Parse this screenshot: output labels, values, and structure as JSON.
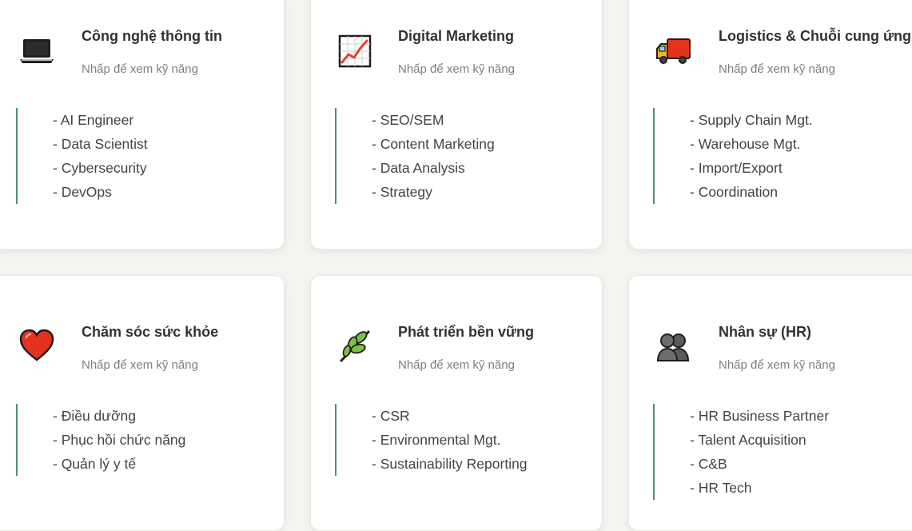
{
  "cards": [
    {
      "title": "Công nghệ thông tin",
      "subtitle": "Nhấp để xem kỹ năng",
      "icon": "laptop-icon",
      "skills": [
        "- AI Engineer",
        "- Data Scientist",
        "- Cybersecurity",
        "- DevOps"
      ]
    },
    {
      "title": "Digital Marketing",
      "subtitle": "Nhấp để xem kỹ năng",
      "icon": "chart-increasing-icon",
      "skills": [
        "- SEO/SEM",
        "- Content Marketing",
        "- Data Analysis",
        "- Strategy"
      ]
    },
    {
      "title": "Logistics & Chuỗi cung ứng",
      "subtitle": "Nhấp để xem kỹ năng",
      "icon": "delivery-truck-icon",
      "skills": [
        "- Supply Chain Mgt.",
        "- Warehouse Mgt.",
        "- Import/Export",
        "- Coordination"
      ]
    },
    {
      "title": "Chăm sóc sức khỏe",
      "subtitle": "Nhấp để xem kỹ năng",
      "icon": "heart-icon",
      "skills": [
        "- Điều dưỡng",
        "- Phục hồi chức năng",
        "- Quản lý y tế"
      ]
    },
    {
      "title": "Phát triển bền vững",
      "subtitle": "Nhấp để xem kỹ năng",
      "icon": "herb-icon",
      "skills": [
        "- CSR",
        "- Environmental Mgt.",
        "- Sustainability Reporting"
      ]
    },
    {
      "title": "Nhân sự (HR)",
      "subtitle": "Nhấp để xem kỹ năng",
      "icon": "busts-icon",
      "skills": [
        "- HR Business Partner",
        "- Talent Acquisition",
        "- C&B",
        "- HR Tech"
      ]
    }
  ],
  "colors": {
    "accent_border": "#4f8f7c",
    "background": "#f5f4f1",
    "card": "#ffffff"
  }
}
